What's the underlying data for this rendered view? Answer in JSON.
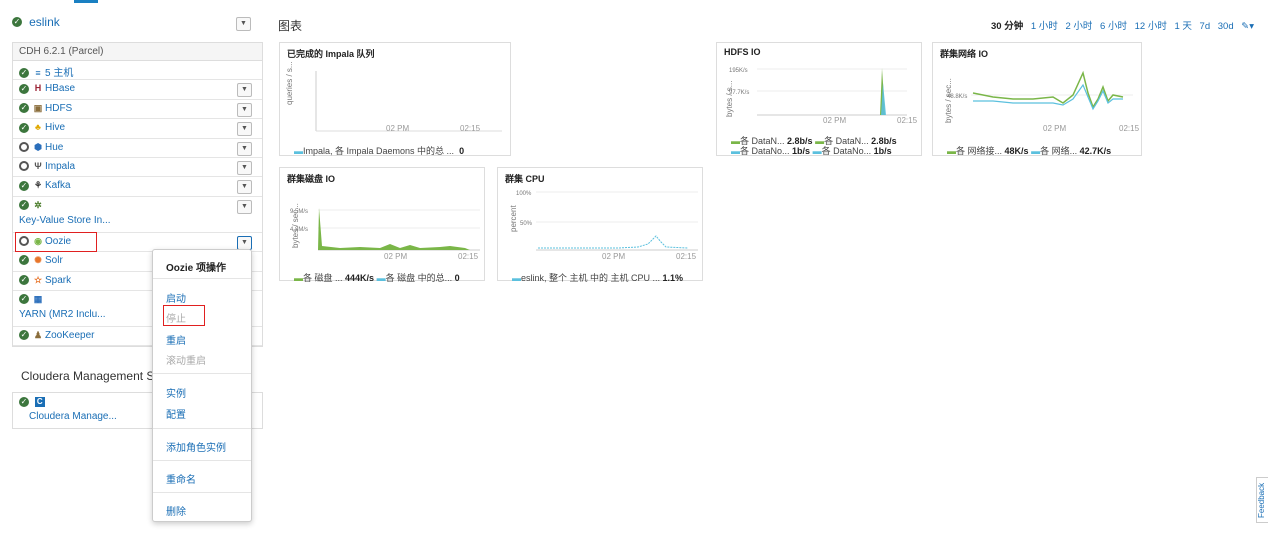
{
  "cluster": {
    "name": "eslink",
    "version": "CDH 6.2.1 (Parcel)"
  },
  "services": [
    {
      "name": "5 主机",
      "status": "ok",
      "icon": "hosts-icon",
      "glyph": "≡",
      "color": "#1a6eb5"
    },
    {
      "name": "HBase",
      "status": "ok",
      "icon": "hbase-icon",
      "glyph": "H",
      "color": "#9b2335"
    },
    {
      "name": "HDFS",
      "status": "ok",
      "icon": "hdfs-icon",
      "glyph": "▣",
      "color": "#8a6d3b"
    },
    {
      "name": "Hive",
      "status": "ok",
      "icon": "hive-icon",
      "glyph": "♣",
      "color": "#e0a800"
    },
    {
      "name": "Hue",
      "status": "stopped",
      "icon": "hue-icon",
      "glyph": "⬢",
      "color": "#2a6ebb"
    },
    {
      "name": "Impala",
      "status": "stopped",
      "icon": "impala-icon",
      "glyph": "Ψ",
      "color": "#555"
    },
    {
      "name": "Kafka",
      "status": "ok",
      "icon": "kafka-icon",
      "glyph": "⚘",
      "color": "#333"
    },
    {
      "name": "",
      "sub": "Key-Value Store In...",
      "status": "ok",
      "icon": "kv-store-icon",
      "glyph": "✲",
      "color": "#4a7c2a"
    },
    {
      "name": "Oozie",
      "status": "stopped",
      "icon": "oozie-icon",
      "glyph": "◉",
      "color": "#7ab648"
    },
    {
      "name": "Solr",
      "status": "ok",
      "icon": "solr-icon",
      "glyph": "✺",
      "color": "#e8752a"
    },
    {
      "name": "Spark",
      "status": "ok",
      "icon": "spark-icon",
      "glyph": "✫",
      "color": "#e8752a"
    },
    {
      "name": "",
      "sub": "YARN (MR2 Inclu...",
      "status": "ok",
      "icon": "yarn-icon",
      "glyph": "▦",
      "color": "#2a6ebb"
    },
    {
      "name": "ZooKeeper",
      "status": "ok",
      "icon": "zookeeper-icon",
      "glyph": "♟",
      "color": "#8a6d3b"
    }
  ],
  "management": {
    "title": "Cloudera Management Ser",
    "item": "Cloudera Manage...",
    "badge": "C"
  },
  "menu": {
    "title": "Oozie 项操作",
    "items": [
      "启动",
      "停止",
      "重启",
      "滚动重启",
      "实例",
      "配置",
      "添加角色实例",
      "重命名",
      "删除"
    ],
    "disabled": [
      "停止",
      "滚动重启"
    ]
  },
  "charts_title": "图表",
  "timebar": {
    "selected": "30 分钟",
    "options": [
      "1 小时",
      "2 小时",
      "6 小时",
      "12 小时",
      "1 天",
      "7d",
      "30d"
    ]
  },
  "charts": {
    "impala": {
      "title": "已完成的 Impala 队列",
      "ylabel": "queries / s...",
      "xticks": [
        "02 PM",
        "02:15"
      ],
      "legend": [
        {
          "label": "Impala, 各 Impala Daemons 中的总 ...",
          "value": "0"
        }
      ]
    },
    "hdfs": {
      "title": "HDFS IO",
      "ylabel": "bytes / s...",
      "yticks": [
        "195K/s",
        "97.7K/s"
      ],
      "xticks": [
        "02 PM",
        "02:15"
      ],
      "legend": [
        {
          "label": "各 DataN...",
          "value": "2.8b/s"
        },
        {
          "label": "各 DataN...",
          "value": "2.8b/s"
        },
        {
          "label": "各 DataNo...",
          "value": "1b/s"
        },
        {
          "label": "各 DataNo...",
          "value": "1b/s"
        }
      ]
    },
    "network": {
      "title": "群集网络 IO",
      "ylabel": "bytes / sec...",
      "yticks": [
        "48.8K/s"
      ],
      "xticks": [
        "02 PM",
        "02:15"
      ],
      "legend": [
        {
          "label": "各 网络接...",
          "value": "48K/s"
        },
        {
          "label": "各 网络...",
          "value": "42.7K/s"
        }
      ]
    },
    "disk": {
      "title": "群集磁盘 IO",
      "ylabel": "bytes / sec...",
      "yticks": [
        "9.5M/s",
        "4.8M/s"
      ],
      "xticks": [
        "02 PM",
        "02:15"
      ],
      "legend": [
        {
          "label": "各 磁盘 ...",
          "value": "444K/s"
        },
        {
          "label": "各 磁盘 中的总...",
          "value": "0"
        }
      ]
    },
    "cpu": {
      "title": "群集 CPU",
      "ylabel": "percent",
      "yticks": [
        "100%",
        "50%"
      ],
      "xticks": [
        "02 PM",
        "02:15"
      ],
      "legend": [
        {
          "label": "eslink, 整个 主机 中的 主机 CPU ...",
          "value": "1.1%"
        }
      ]
    }
  },
  "feedback": "Feedback",
  "colors": {
    "link": "#1a6eb5",
    "ok": "#3c763d",
    "highlight": "#e02020",
    "series_green": "#7ab648",
    "series_blue": "#5bc0de"
  }
}
